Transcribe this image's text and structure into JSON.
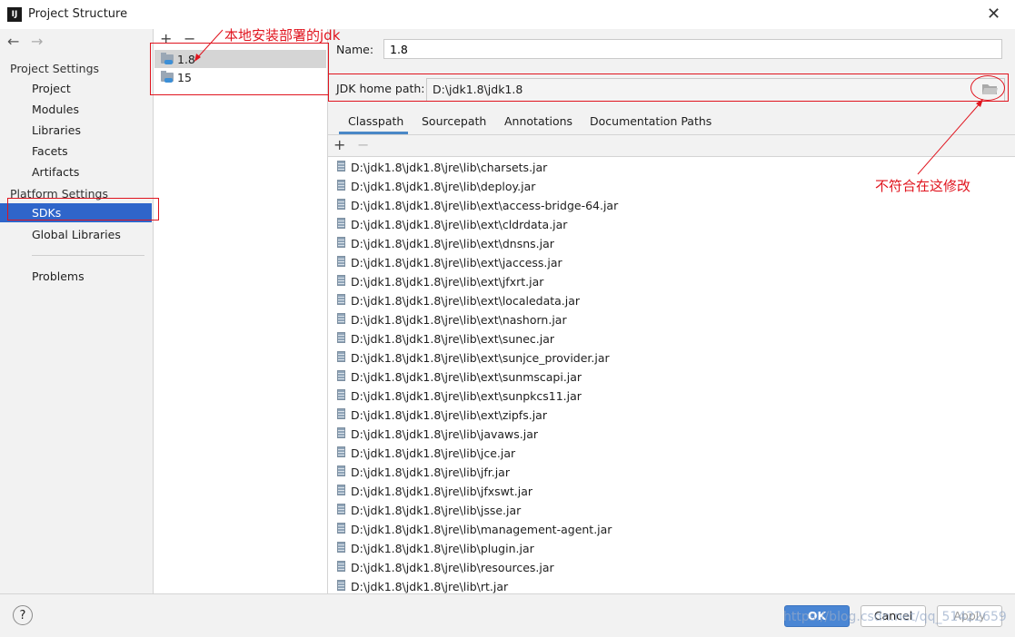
{
  "window": {
    "title": "Project Structure",
    "app_icon": "IJ"
  },
  "nav": {
    "back": "←",
    "forward": "→",
    "project_settings": "Project Settings",
    "items_project": [
      "Project",
      "Modules",
      "Libraries",
      "Facets",
      "Artifacts"
    ],
    "platform_settings": "Platform Settings",
    "sdks": "SDKs",
    "global_libraries": "Global Libraries",
    "problems": "Problems"
  },
  "sdk_list": {
    "add": "+",
    "remove": "−",
    "items": [
      "1.8",
      "15"
    ],
    "selected": "1.8"
  },
  "sdk_detail": {
    "name_label": "Name:",
    "name_value": "1.8",
    "home_label": "JDK home path:",
    "home_value": "D:\\jdk1.8\\jdk1.8",
    "tabs": [
      "Classpath",
      "Sourcepath",
      "Annotations",
      "Documentation Paths"
    ],
    "active_tab": "Classpath",
    "add": "+",
    "remove": "−",
    "classpath": [
      "D:\\jdk1.8\\jdk1.8\\jre\\lib\\charsets.jar",
      "D:\\jdk1.8\\jdk1.8\\jre\\lib\\deploy.jar",
      "D:\\jdk1.8\\jdk1.8\\jre\\lib\\ext\\access-bridge-64.jar",
      "D:\\jdk1.8\\jdk1.8\\jre\\lib\\ext\\cldrdata.jar",
      "D:\\jdk1.8\\jdk1.8\\jre\\lib\\ext\\dnsns.jar",
      "D:\\jdk1.8\\jdk1.8\\jre\\lib\\ext\\jaccess.jar",
      "D:\\jdk1.8\\jdk1.8\\jre\\lib\\ext\\jfxrt.jar",
      "D:\\jdk1.8\\jdk1.8\\jre\\lib\\ext\\localedata.jar",
      "D:\\jdk1.8\\jdk1.8\\jre\\lib\\ext\\nashorn.jar",
      "D:\\jdk1.8\\jdk1.8\\jre\\lib\\ext\\sunec.jar",
      "D:\\jdk1.8\\jdk1.8\\jre\\lib\\ext\\sunjce_provider.jar",
      "D:\\jdk1.8\\jdk1.8\\jre\\lib\\ext\\sunmscapi.jar",
      "D:\\jdk1.8\\jdk1.8\\jre\\lib\\ext\\sunpkcs11.jar",
      "D:\\jdk1.8\\jdk1.8\\jre\\lib\\ext\\zipfs.jar",
      "D:\\jdk1.8\\jdk1.8\\jre\\lib\\javaws.jar",
      "D:\\jdk1.8\\jdk1.8\\jre\\lib\\jce.jar",
      "D:\\jdk1.8\\jdk1.8\\jre\\lib\\jfr.jar",
      "D:\\jdk1.8\\jdk1.8\\jre\\lib\\jfxswt.jar",
      "D:\\jdk1.8\\jdk1.8\\jre\\lib\\jsse.jar",
      "D:\\jdk1.8\\jdk1.8\\jre\\lib\\management-agent.jar",
      "D:\\jdk1.8\\jdk1.8\\jre\\lib\\plugin.jar",
      "D:\\jdk1.8\\jdk1.8\\jre\\lib\\resources.jar",
      "D:\\jdk1.8\\jdk1.8\\jre\\lib\\rt.jar"
    ]
  },
  "footer": {
    "help": "?",
    "ok": "OK",
    "cancel": "Cancel",
    "apply": "Apply",
    "watermark": "https://blog.csdn.net/qq_51422659"
  },
  "annotations": {
    "local_jdk_note": "本地安装部署的jdk",
    "wrong_path_note": "不符合在这修改"
  },
  "colors": {
    "selection": "#2f65ca",
    "annotation_red": "#e0141e",
    "ok_button": "#4a86d4"
  }
}
